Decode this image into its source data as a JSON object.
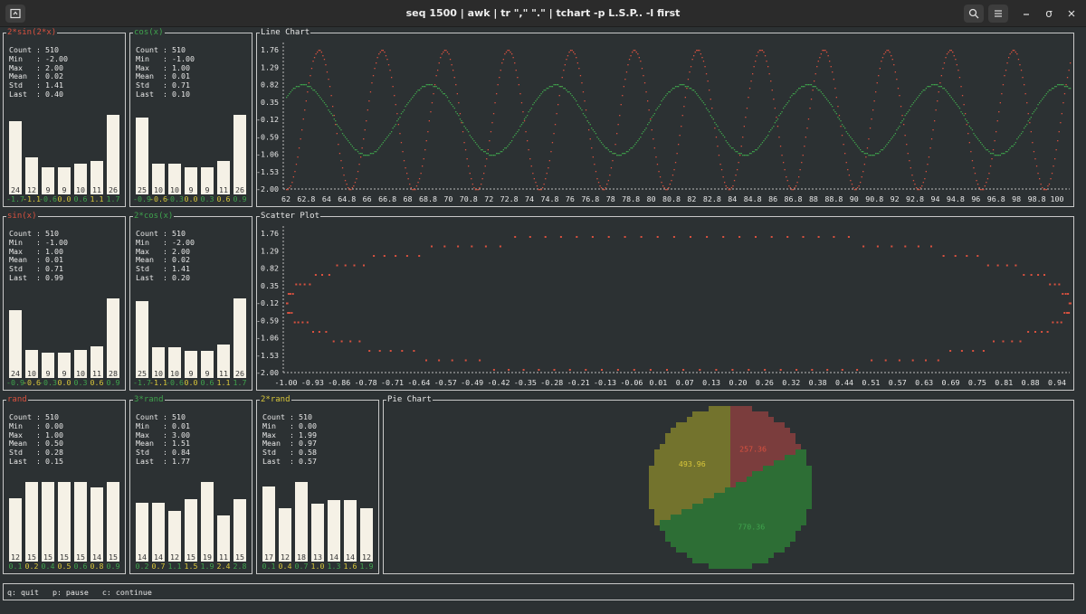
{
  "window": {
    "title": "seq 1500 | awk  | tr \",\" \".\" | tchart -p L.S.P.. -l first"
  },
  "colors": {
    "bg": "#2c3133",
    "border": "#c8c8c8",
    "red": "#d9513f",
    "green": "#3fa34d",
    "yellow": "#d8c63a",
    "bar": "#f5f1e6",
    "pie_red": "#7b3d3d",
    "pie_green": "#2d6e35",
    "pie_yellow": "#73732d",
    "text": "#e8e8e8"
  },
  "icons": {
    "app": "terminal-tab-icon",
    "search": "search-icon",
    "menu": "hamburger-menu-icon",
    "minimize": "minimize-icon",
    "restore": "restore-icon",
    "close": "close-icon"
  },
  "stat_labels": {
    "count": "Count :",
    "min": "Min   :",
    "max": "Max   :",
    "mean": "Mean  :",
    "std": "Std   :",
    "last": "Last  :"
  },
  "panels": [
    {
      "title": "2*sin(2*x)",
      "title_color": "#d9513f",
      "stats": {
        "count": "510",
        "min": "-2.00",
        "max": "2.00",
        "mean": "0.02",
        "std": "1.41",
        "last": "0.40"
      },
      "hist": {
        "counts": [
          "24",
          "12",
          "9",
          "9",
          "10",
          "11",
          "26"
        ],
        "bins": [
          "-1.7",
          "-1.1",
          "-0.6",
          "0.0",
          "0.6",
          "1.1",
          "1.7"
        ],
        "bin_colors": [
          "#3fa34d",
          "#d8c63a",
          "#3fa34d",
          "#d8c63a",
          "#3fa34d",
          "#d8c63a",
          "#3fa34d"
        ]
      }
    },
    {
      "title": "cos(x)",
      "title_color": "#3fa34d",
      "stats": {
        "count": "510",
        "min": "-1.00",
        "max": "1.00",
        "mean": "0.01",
        "std": "0.71",
        "last": "0.10"
      },
      "hist": {
        "counts": [
          "25",
          "10",
          "10",
          "9",
          "9",
          "11",
          "26"
        ],
        "bins": [
          "-0.9",
          "-0.6",
          "-0.3",
          "0.0",
          "0.3",
          "0.6",
          "0.9"
        ],
        "bin_colors": [
          "#3fa34d",
          "#d8c63a",
          "#3fa34d",
          "#d8c63a",
          "#3fa34d",
          "#d8c63a",
          "#3fa34d"
        ]
      }
    },
    {
      "title": "sin(x)",
      "title_color": "#d9513f",
      "stats": {
        "count": "510",
        "min": "-1.00",
        "max": "1.00",
        "mean": "0.01",
        "std": "0.71",
        "last": "0.99"
      },
      "hist": {
        "counts": [
          "24",
          "10",
          "9",
          "9",
          "10",
          "11",
          "28"
        ],
        "bins": [
          "-0.9",
          "-0.6",
          "-0.3",
          "0.0",
          "0.3",
          "0.6",
          "0.9"
        ],
        "bin_colors": [
          "#3fa34d",
          "#d8c63a",
          "#3fa34d",
          "#d8c63a",
          "#3fa34d",
          "#d8c63a",
          "#3fa34d"
        ]
      }
    },
    {
      "title": "2*cos(x)",
      "title_color": "#3fa34d",
      "stats": {
        "count": "510",
        "min": "-2.00",
        "max": "2.00",
        "mean": "0.02",
        "std": "1.41",
        "last": "0.20"
      },
      "hist": {
        "counts": [
          "25",
          "10",
          "10",
          "9",
          "9",
          "11",
          "26"
        ],
        "bins": [
          "-1.7",
          "-1.1",
          "-0.6",
          "0.0",
          "0.6",
          "1.1",
          "1.7"
        ],
        "bin_colors": [
          "#3fa34d",
          "#d8c63a",
          "#3fa34d",
          "#d8c63a",
          "#3fa34d",
          "#d8c63a",
          "#3fa34d"
        ]
      }
    },
    {
      "title": "rand",
      "title_color": "#d9513f",
      "stats": {
        "count": "510",
        "min": "0.00",
        "max": "1.00",
        "mean": "0.50",
        "std": "0.28",
        "last": "0.15"
      },
      "hist": {
        "counts": [
          "12",
          "15",
          "15",
          "15",
          "15",
          "14",
          "15"
        ],
        "bins": [
          "0.1",
          "0.2",
          "0.4",
          "0.5",
          "0.6",
          "0.8",
          "0.9"
        ],
        "bin_colors": [
          "#3fa34d",
          "#d8c63a",
          "#3fa34d",
          "#d8c63a",
          "#3fa34d",
          "#d8c63a",
          "#3fa34d"
        ]
      }
    },
    {
      "title": "3*rand",
      "title_color": "#3fa34d",
      "stats": {
        "count": "510",
        "min": "0.01",
        "max": "3.00",
        "mean": "1.51",
        "std": "0.84",
        "last": "1.77"
      },
      "hist": {
        "counts": [
          "14",
          "14",
          "12",
          "15",
          "19",
          "11",
          "15"
        ],
        "bins": [
          "0.2",
          "0.7",
          "1.1",
          "1.5",
          "1.9",
          "2.4",
          "2.8"
        ],
        "bin_colors": [
          "#3fa34d",
          "#d8c63a",
          "#3fa34d",
          "#d8c63a",
          "#3fa34d",
          "#d8c63a",
          "#3fa34d"
        ]
      }
    },
    {
      "title": "2*rand",
      "title_color": "#d8c63a",
      "stats": {
        "count": "510",
        "min": "0.00",
        "max": "1.99",
        "mean": "0.97",
        "std": "0.58",
        "last": "0.57"
      },
      "hist": {
        "counts": [
          "17",
          "12",
          "18",
          "13",
          "14",
          "14",
          "12"
        ],
        "bins": [
          "0.1",
          "0.4",
          "0.7",
          "1.0",
          "1.3",
          "1.6",
          "1.9"
        ],
        "bin_colors": [
          "#3fa34d",
          "#d8c63a",
          "#3fa34d",
          "#d8c63a",
          "#3fa34d",
          "#d8c63a",
          "#3fa34d"
        ]
      }
    }
  ],
  "footer": {
    "text": "q: quit   p: pause   c: continue"
  },
  "chart_data": [
    {
      "type": "line",
      "title": "Line Chart",
      "ylim": [
        -2.0,
        2.0
      ],
      "yticks": [
        "1.76",
        "1.29",
        "0.82",
        "0.35",
        "-0.12",
        "-0.59",
        "-1.06",
        "-1.53",
        "-2.00"
      ],
      "xlim": [
        62,
        101
      ],
      "xticks": [
        "62",
        "62.8",
        "64",
        "64.8",
        "66",
        "66.8",
        "68",
        "68.8",
        "70",
        "70.8",
        "72",
        "72.8",
        "74",
        "74.8",
        "76",
        "76.8",
        "78",
        "78.8",
        "80",
        "80.8",
        "82",
        "82.8",
        "84",
        "84.8",
        "86",
        "86.8",
        "88",
        "88.8",
        "90",
        "90.8",
        "92",
        "92.8",
        "94",
        "94.8",
        "96",
        "96.8",
        "98",
        "98.8",
        "100"
      ],
      "series": [
        {
          "color": "#d9513f",
          "function": "2*sin(2*x)",
          "amplitude": 2.0,
          "frequency": 2.0
        },
        {
          "color": "#3fa34d",
          "function": "cos(x)",
          "amplitude": 1.0,
          "frequency": 1.0
        }
      ]
    },
    {
      "type": "scatter",
      "title": "Scatter Plot",
      "ylim": [
        -2.0,
        2.0
      ],
      "yticks": [
        "1.76",
        "1.29",
        "0.82",
        "0.35",
        "-0.12",
        "-0.59",
        "-1.06",
        "-1.53",
        "-2.00"
      ],
      "xlim": [
        -1.0,
        1.0
      ],
      "xticks": [
        "-1.00",
        "-0.93",
        "-0.86",
        "-0.78",
        "-0.71",
        "-0.64",
        "-0.57",
        "-0.49",
        "-0.42",
        "-0.35",
        "-0.28",
        "-0.21",
        "-0.13",
        "-0.06",
        "0.01",
        "0.07",
        "0.13",
        "0.20",
        "0.26",
        "0.32",
        "0.38",
        "0.44",
        "0.51",
        "0.57",
        "0.63",
        "0.69",
        "0.75",
        "0.81",
        "0.88",
        "0.94"
      ],
      "series": [
        {
          "color": "#d9513f",
          "x_function": "sin(x)",
          "y_function": "2*cos(x)"
        }
      ]
    },
    {
      "type": "pie",
      "title": "Pie Chart",
      "slices": [
        {
          "value": 257.36,
          "label": "257.36",
          "color": "#7b3d3d",
          "label_color": "#d9513f"
        },
        {
          "value": 770.36,
          "label": "770.36",
          "color": "#2d6e35",
          "label_color": "#3fa34d"
        },
        {
          "value": 493.96,
          "label": "493.96",
          "color": "#73732d",
          "label_color": "#d8c63a"
        }
      ]
    }
  ]
}
